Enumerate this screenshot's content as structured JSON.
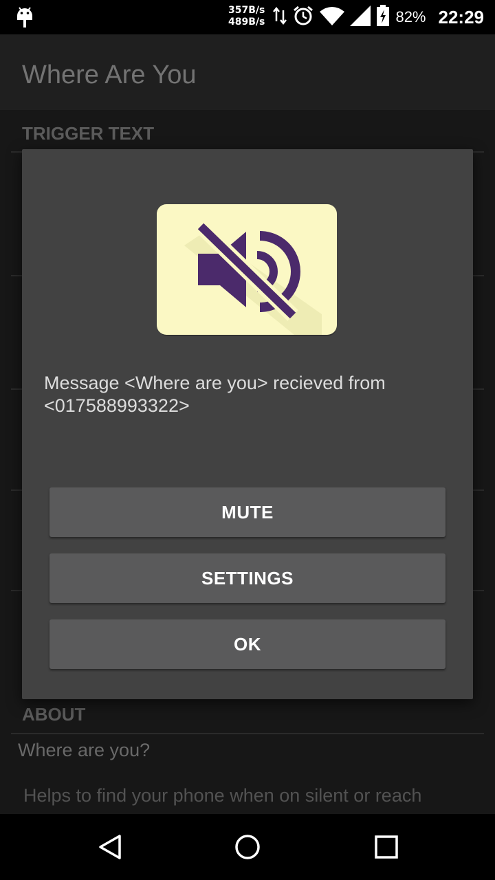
{
  "status_bar": {
    "net_up": "357B/s",
    "net_down": "489B/s",
    "battery_percent": "82%",
    "time": "22:29",
    "icons": [
      "android-debug-icon",
      "data-transfer-icon",
      "alarm-icon",
      "wifi-icon",
      "cell-signal-icon",
      "battery-charging-icon"
    ]
  },
  "background": {
    "app_title": "Where Are You",
    "section_trigger": "TRIGGER TEXT",
    "section_about": "ABOUT",
    "about_item": "Where are you?",
    "about_description": "Helps to find your phone when on silent or reach"
  },
  "dialog": {
    "icon": "mute-speaker-icon",
    "message": "Message <Where are you> recieved from <017588993322>",
    "buttons": {
      "mute": "MUTE",
      "settings": "SETTINGS",
      "ok": "OK"
    }
  },
  "colors": {
    "icon_background": "#fbf8c4",
    "icon_foreground": "#4b2a6b",
    "dialog_background": "#424242",
    "button_background": "#5a5a5b"
  },
  "nav_bar": {
    "icons": [
      "back-icon",
      "home-icon",
      "recents-icon"
    ]
  }
}
